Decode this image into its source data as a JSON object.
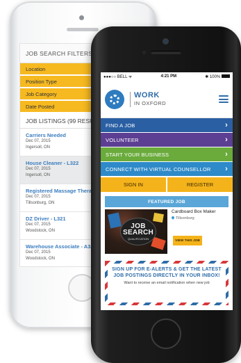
{
  "back_screen": {
    "filters_heading": "JOB SEARCH FILTERS",
    "filters": [
      "Location",
      "Position Type",
      "Job Category",
      "Date Posted"
    ],
    "listings_heading": "JOB LISTINGS (99 RESULTS)",
    "jobs": [
      {
        "title": "Carriers Needed",
        "date": "Dec 07, 2015",
        "location": "Ingersoll, ON"
      },
      {
        "title": "House Cleaner - L322",
        "date": "Dec 07, 2015",
        "location": "Ingersoll, ON"
      },
      {
        "title": "Registered Massage Therapist",
        "date": "Dec 07, 2015",
        "location": "Tillsonburg, ON"
      },
      {
        "title": "DZ Driver - L321",
        "date": "Dec 07, 2015",
        "location": "Woodstock, ON"
      },
      {
        "title": "Warehouse Associate - A320",
        "date": "Dec 07, 2015",
        "location": "Woodstock, ON"
      }
    ]
  },
  "status_bar": {
    "carrier": "●●●○○ BELL ᯤ",
    "time": "4:21 PM",
    "battery": "✱ 100%"
  },
  "brand": {
    "line1": "WORK",
    "line2": "IN OXFORD",
    "logo_icon": "gear-icon"
  },
  "nav": [
    {
      "label": "FIND A JOB",
      "color": "#2a5fa3"
    },
    {
      "label": "VOLUNTEER",
      "color": "#5c3e93"
    },
    {
      "label": "START YOUR BUSINESS",
      "color": "#6aab3c"
    },
    {
      "label": "CONNECT WITH VIRTUAL COUNSELLOR",
      "color": "#2e8ac8"
    }
  ],
  "auth": {
    "sign_in": "SIGN IN",
    "register": "REGISTER"
  },
  "featured": {
    "heading": "FEATURED JOB",
    "image_text_big": "JOB SEARCH",
    "image_text_small": "QUALIFICATION",
    "title": "Cardboard Box Maker",
    "location": "Tillsonburg",
    "button": "VIEW THIS JOB"
  },
  "alerts": {
    "title": "SIGN UP FOR E-ALERTS & GET THE LATEST JOB POSTINGS DIRECTLY IN YOUR INBOX!",
    "body": "Want to receive an email notification when new job"
  },
  "colors": {
    "accent_yellow": "#f5b31b",
    "brand_blue": "#2f6ca8",
    "featured_blue": "#5aa6d8"
  }
}
